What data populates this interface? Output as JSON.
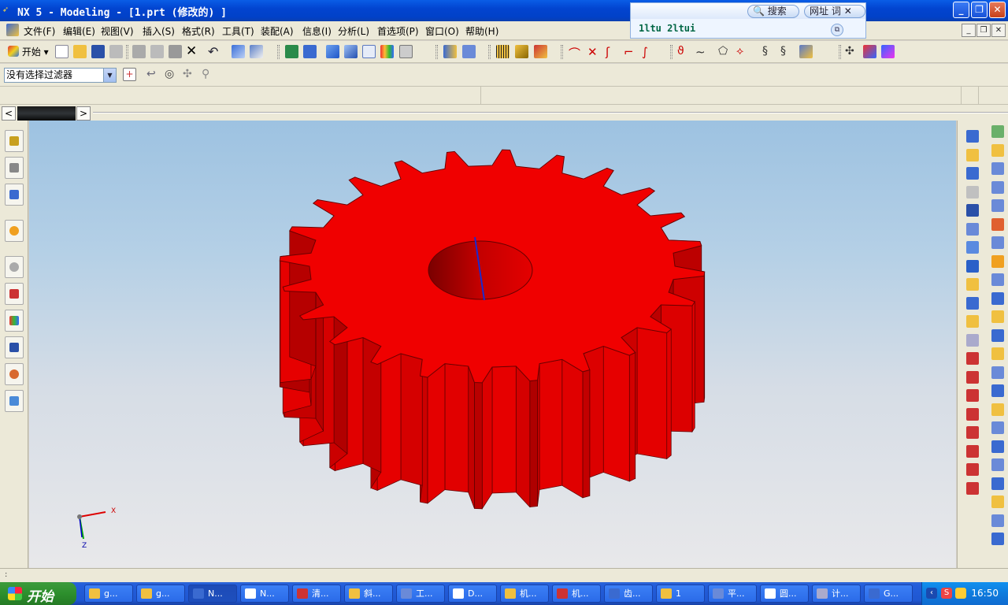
{
  "window": {
    "title": "NX 5 - Modeling - [1.prt  (修改的) ]",
    "minimize": "_",
    "restore": "❐",
    "close": "✕"
  },
  "ime": {
    "search_label": "搜索",
    "url_label": "网址",
    "word_label": "词",
    "close_label": "✕",
    "input_text": "1ltu 2ltui"
  },
  "menu": {
    "items": [
      "文件(F)",
      "编辑(E)",
      "视图(V)",
      "插入(S)",
      "格式(R)",
      "工具(T)",
      "装配(A)",
      "信息(I)",
      "分析(L)",
      "首选项(P)",
      "窗口(O)",
      "帮助(H)"
    ]
  },
  "toolbar": {
    "start_label": "开始",
    "filter_value": "没有选择过滤器"
  },
  "scroll": {
    "left": "<",
    "right": ">"
  },
  "triad": {
    "x_label": "X",
    "z_label": "Z"
  },
  "taskbar": {
    "start_label": "开始",
    "tasks": [
      "g...",
      "g...",
      "N...",
      "N...",
      "清...",
      "斜...",
      "工...",
      "D...",
      "机...",
      "机...",
      "齿...",
      "1",
      "平...",
      "圆...",
      "计...",
      "G..."
    ],
    "clock": "16:50"
  },
  "colors": {
    "gear": "#e00000",
    "titlebar": "#0244d0",
    "taskbar": "#245edb",
    "start": "#2d8f2d"
  }
}
